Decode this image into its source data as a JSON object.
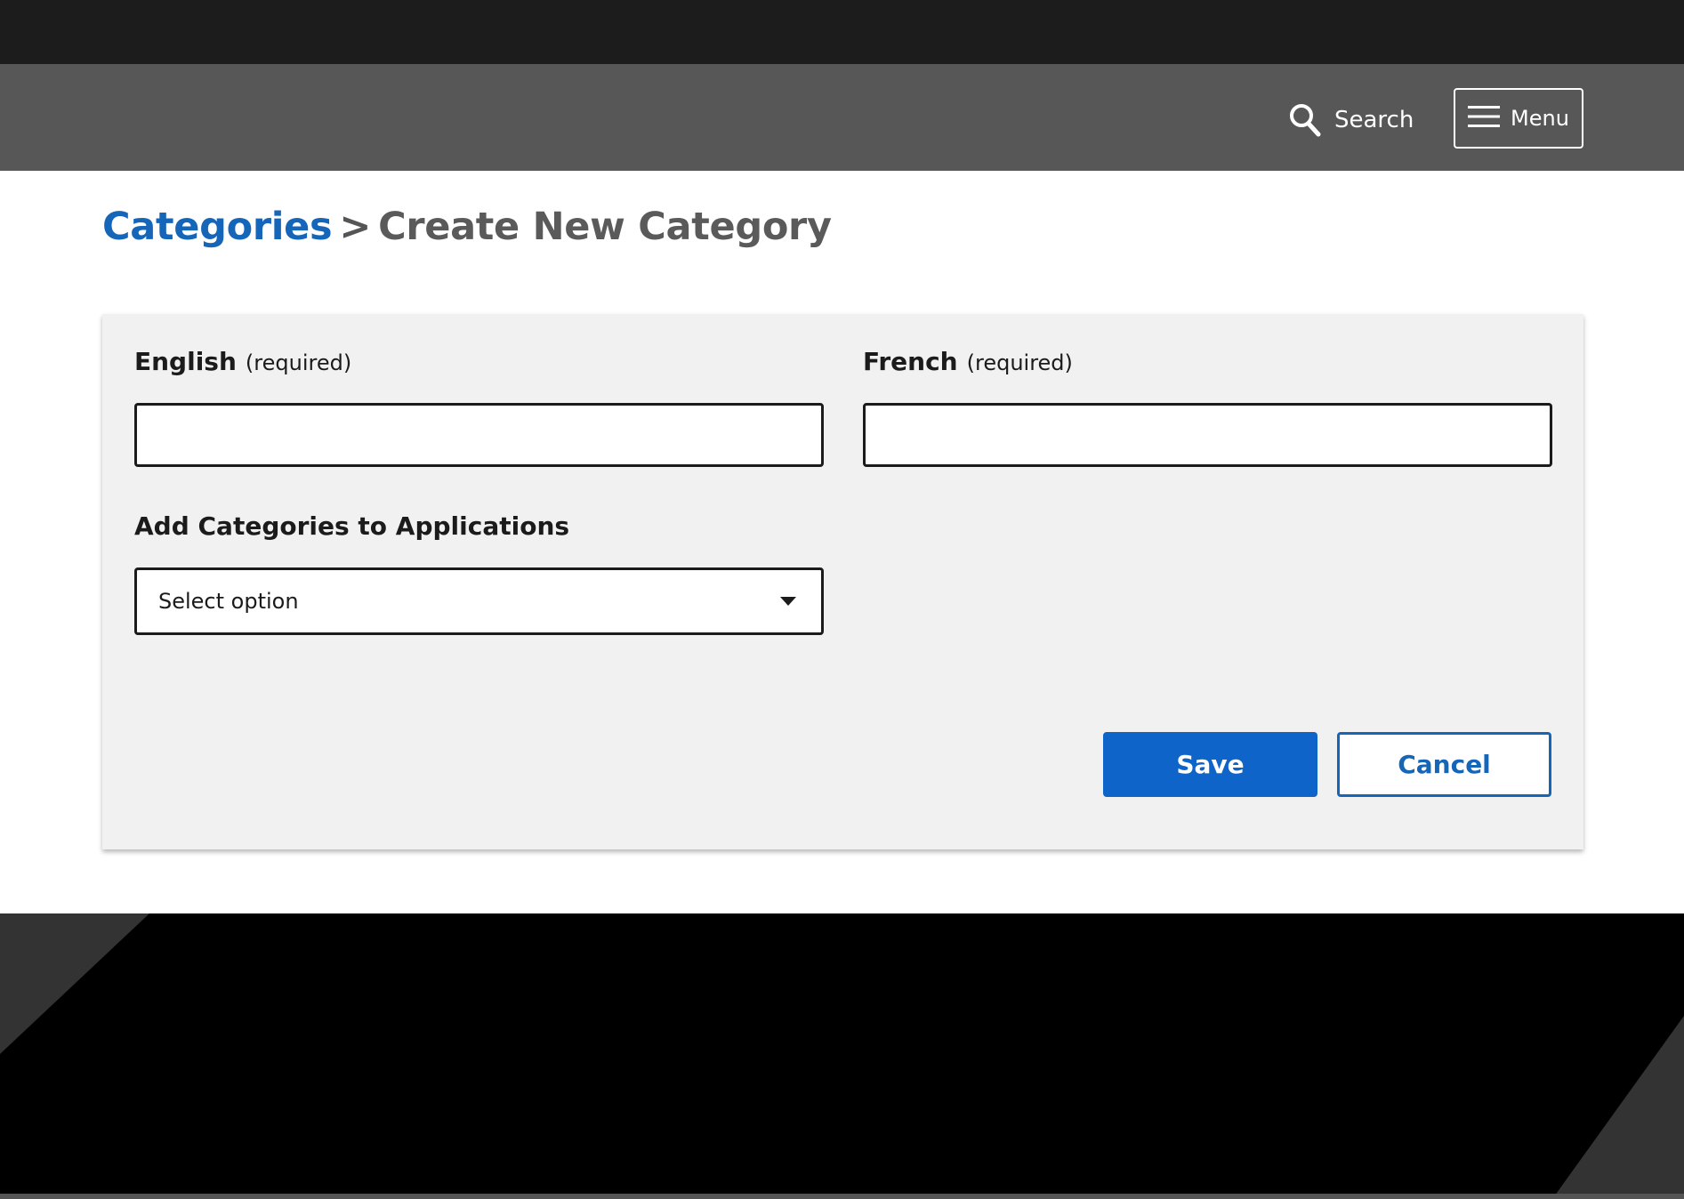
{
  "header": {
    "search_label": "Search",
    "menu_label": "Menu"
  },
  "breadcrumb": {
    "parent": "Categories",
    "separator": ">",
    "current": "Create New Category"
  },
  "form": {
    "english": {
      "label": "English",
      "hint": "(required)",
      "value": ""
    },
    "french": {
      "label": "French",
      "hint": "(required)",
      "value": ""
    },
    "applications": {
      "label": "Add Categories to Applications",
      "selected": "Select option"
    },
    "save_label": "Save",
    "cancel_label": "Cancel"
  },
  "colors": {
    "top_strip": "#1c1c1c",
    "header_bar": "#575757",
    "link_blue": "#1565b8",
    "primary_button": "#0e64c8",
    "card_background": "#f1f1f1",
    "footer": "#000000"
  },
  "icons": {
    "search": "search-icon",
    "menu": "hamburger-icon",
    "dropdown": "chevron-down-icon"
  }
}
